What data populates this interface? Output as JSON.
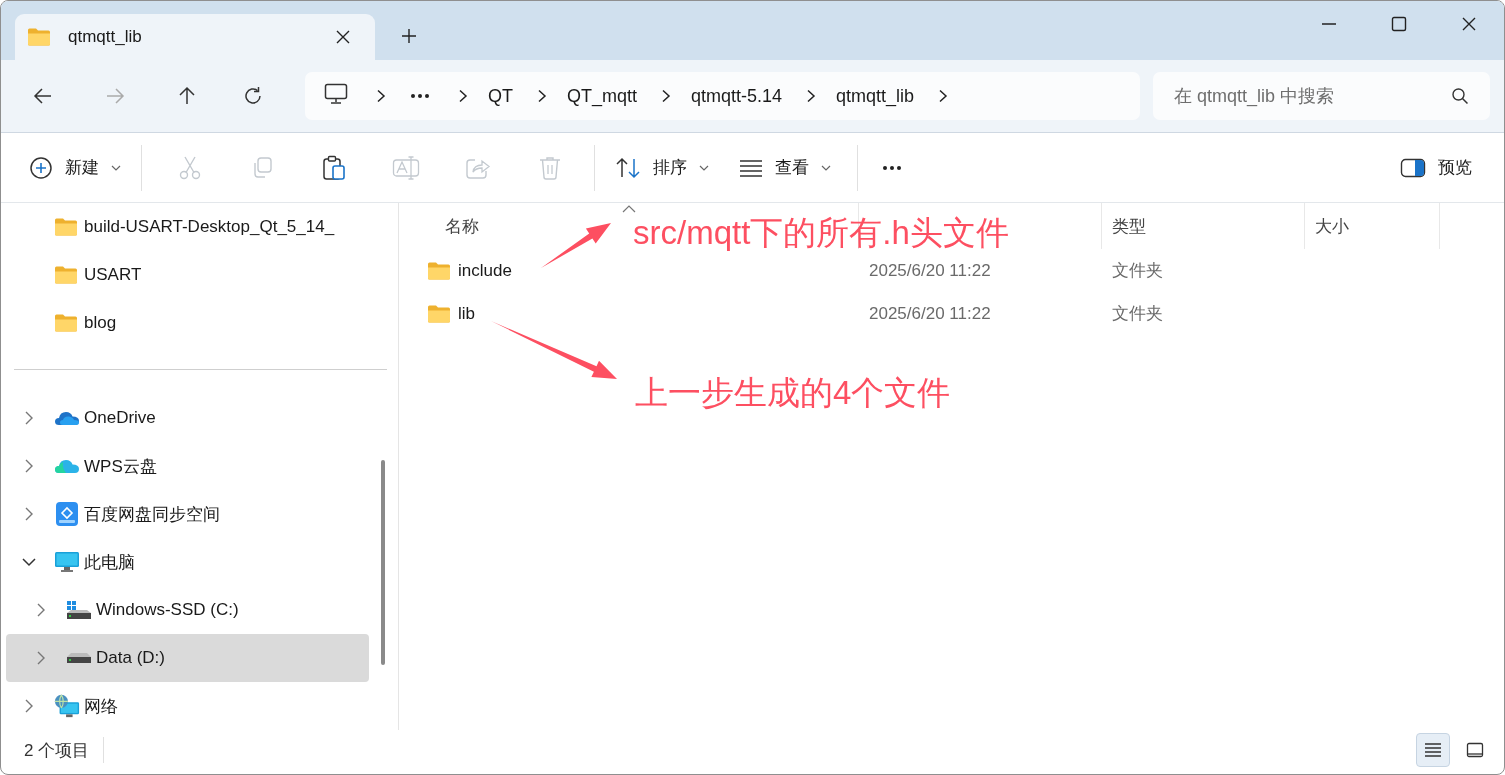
{
  "window": {
    "tab_title": "qtmqtt_lib"
  },
  "address_bar": {
    "segments": [
      "QT",
      "QT_mqtt",
      "qtmqtt-5.14",
      "qtmqtt_lib"
    ]
  },
  "search": {
    "placeholder": "在 qtmqtt_lib 中搜索"
  },
  "toolbar": {
    "new_label": "新建",
    "actions": [
      {
        "kind": "cut",
        "disabled": true
      },
      {
        "kind": "copy",
        "disabled": true
      },
      {
        "kind": "paste",
        "disabled": false
      },
      {
        "kind": "rename",
        "disabled": true
      },
      {
        "kind": "share",
        "disabled": true
      },
      {
        "kind": "delete",
        "disabled": true
      }
    ],
    "sort_label": "排序",
    "view_label": "查看",
    "preview_label": "预览"
  },
  "sidebar": {
    "pinned": [
      {
        "label": "build-USART-Desktop_Qt_5_14_"
      },
      {
        "label": "USART"
      },
      {
        "label": "blog"
      }
    ],
    "tree": [
      {
        "kind": "onedrive",
        "label": "OneDrive",
        "expanded": false,
        "selected": false
      },
      {
        "kind": "wps",
        "label": "WPS云盘",
        "expanded": false,
        "selected": false
      },
      {
        "kind": "baidu",
        "label": "百度网盘同步空间",
        "expanded": false,
        "selected": false
      },
      {
        "kind": "pc",
        "label": "此电脑",
        "expanded": true,
        "selected": false,
        "children": [
          {
            "kind": "system-drive",
            "label": "Windows-SSD (C:)",
            "expanded": false,
            "selected": false
          },
          {
            "kind": "drive",
            "label": "Data (D:)",
            "expanded": false,
            "selected": true
          }
        ]
      },
      {
        "kind": "network",
        "label": "网络",
        "expanded": false,
        "selected": false
      }
    ]
  },
  "file_list": {
    "columns": [
      {
        "label": "名称",
        "sorted": true
      },
      {
        "sorted": false
      },
      {
        "label": "类型",
        "sorted": false
      },
      {
        "label": "大小",
        "sorted": false
      }
    ],
    "rows": [
      {
        "name": "include",
        "modified": "2025/6/20 11:22",
        "type": "文件夹"
      },
      {
        "name": "lib",
        "modified": "2025/6/20 11:22",
        "type": "文件夹"
      }
    ]
  },
  "status_bar": {
    "item_count": "2 个项目",
    "views": [
      {
        "kind": "details",
        "selected": true
      },
      {
        "kind": "tiles",
        "selected": false
      }
    ]
  },
  "annotations": [
    {
      "text": "src/mqtt下的所有.h头文件"
    },
    {
      "text": "上一步生成的4个文件"
    }
  ]
}
